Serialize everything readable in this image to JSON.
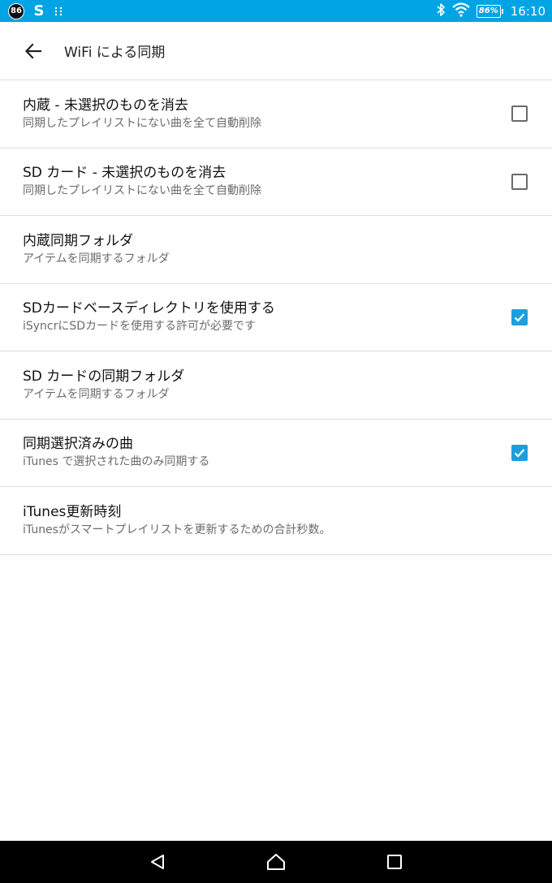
{
  "status_bar": {
    "notification_badge": "86",
    "notification_s": "S",
    "battery": "86%",
    "time": "16:10",
    "color": "#00a4e4"
  },
  "toolbar": {
    "title": "WiFi による同期",
    "back_icon": "arrow-back-icon"
  },
  "settings": [
    {
      "title": "内蔵 - 未選択のものを消去",
      "subtitle": "同期したプレイリストにない曲を全て自動削除",
      "has_checkbox": true,
      "checked": false
    },
    {
      "title": "SD カード - 未選択のものを消去",
      "subtitle": "同期したプレイリストにない曲を全て自動削除",
      "has_checkbox": true,
      "checked": false
    },
    {
      "title": "内蔵同期フォルダ",
      "subtitle": "アイテムを同期するフォルダ",
      "has_checkbox": false
    },
    {
      "title": "SDカードベースディレクトリを使用する",
      "subtitle": "iSyncrにSDカードを使用する許可が必要です",
      "has_checkbox": true,
      "checked": true
    },
    {
      "title": "SD カードの同期フォルダ",
      "subtitle": "アイテムを同期するフォルダ",
      "has_checkbox": false
    },
    {
      "title": "同期選択済みの曲",
      "subtitle": "iTunes で選択された曲のみ同期する",
      "has_checkbox": true,
      "checked": true
    },
    {
      "title": "iTunes更新時刻",
      "subtitle": "iTunesがスマートプレイリストを更新するための合計秒数。",
      "has_checkbox": false
    }
  ],
  "accent_color": "#1aa0e0",
  "nav_bar": {
    "back_icon": "nav-back-icon",
    "home_icon": "nav-home-icon",
    "recents_icon": "nav-recents-icon"
  }
}
